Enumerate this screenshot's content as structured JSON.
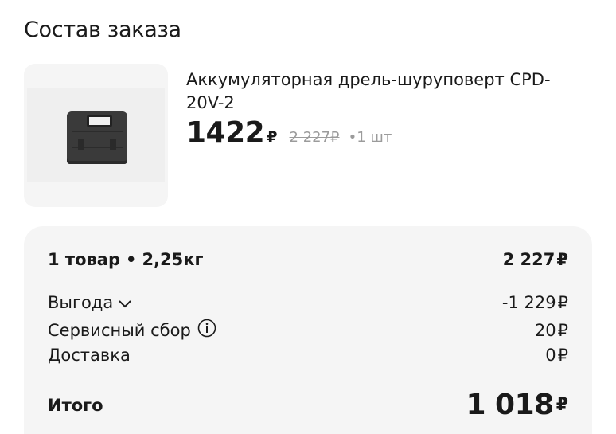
{
  "header": {
    "title": "Состав заказа"
  },
  "product": {
    "name": "Аккумуляторная дрель-шуруповерт CPD-20V-2",
    "image_icon": "tool-case-image",
    "price": "1422",
    "currency": "₽",
    "old_price": "2 227₽",
    "quantity": "1 шт"
  },
  "summary": {
    "items_label": "1 товар",
    "weight": "2,25кг",
    "items_total": "2 227",
    "benefit_label": "Выгода",
    "benefit_value": "-1 229",
    "service_fee_label": "Сервисный сбор",
    "service_fee_value": "20",
    "delivery_label": "Доставка",
    "delivery_value": "0",
    "total_label": "Итого",
    "total_value": "1 018",
    "currency": "₽"
  }
}
